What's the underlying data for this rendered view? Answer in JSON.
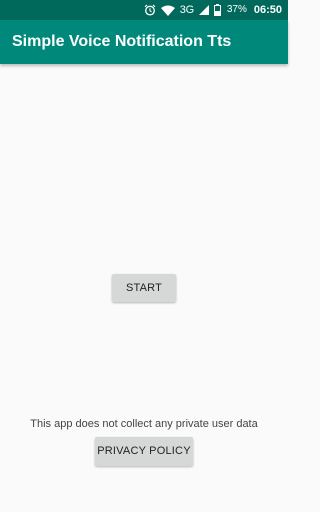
{
  "status_bar": {
    "network": "3G",
    "battery": "37%",
    "time": "06:50",
    "icons": [
      "alarm-icon",
      "wifi-icon",
      "signal-icon",
      "battery-icon"
    ]
  },
  "app_bar": {
    "title": "Simple Voice Notification Tts"
  },
  "main": {
    "start_label": "START",
    "privacy_note": "This app does not collect any private user data",
    "privacy_label": "PRIVACY POLICY"
  },
  "colors": {
    "status_bar": "#00695c",
    "app_bar": "#00897b",
    "background": "#fafafa",
    "button": "#d6d7d7"
  }
}
